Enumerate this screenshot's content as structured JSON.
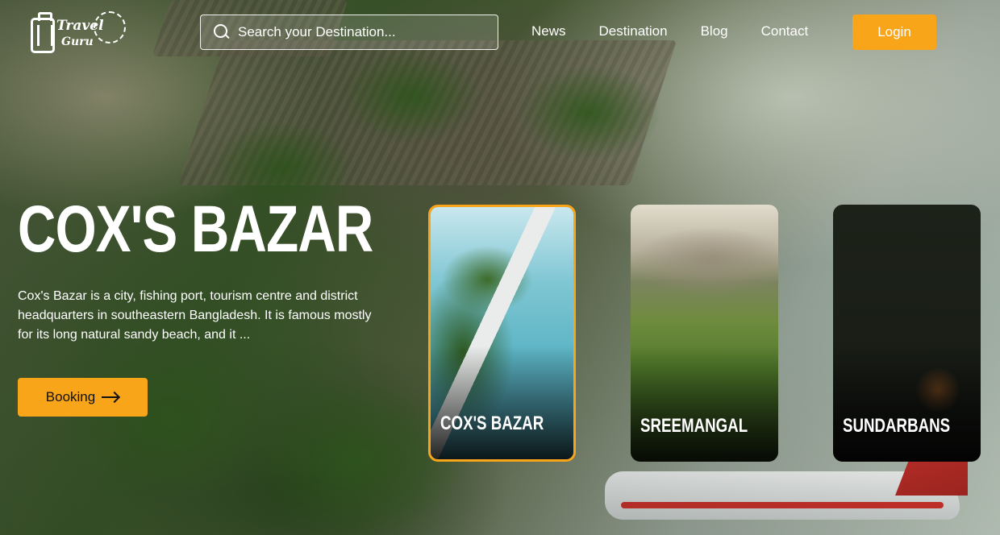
{
  "brand": {
    "line1": "Travel",
    "line2": "Guru"
  },
  "search": {
    "placeholder": "Search your Destination..."
  },
  "nav": {
    "items": [
      "News",
      "Destination",
      "Blog",
      "Contact"
    ]
  },
  "login_label": "Login",
  "hero": {
    "title": "COX'S BAZAR",
    "description": "Cox's Bazar is a city, fishing port, tourism centre and district headquarters in southeastern Bangladesh. It is famous mostly for its long natural sandy beach, and it ...",
    "booking_label": "Booking"
  },
  "cards": [
    {
      "label": "COX'S BAZAR",
      "active": true
    },
    {
      "label": "SREEMANGAL",
      "active": false
    },
    {
      "label": "SUNDARBANS",
      "active": false
    }
  ],
  "colors": {
    "accent": "#f9a51a",
    "text": "#ffffff"
  }
}
